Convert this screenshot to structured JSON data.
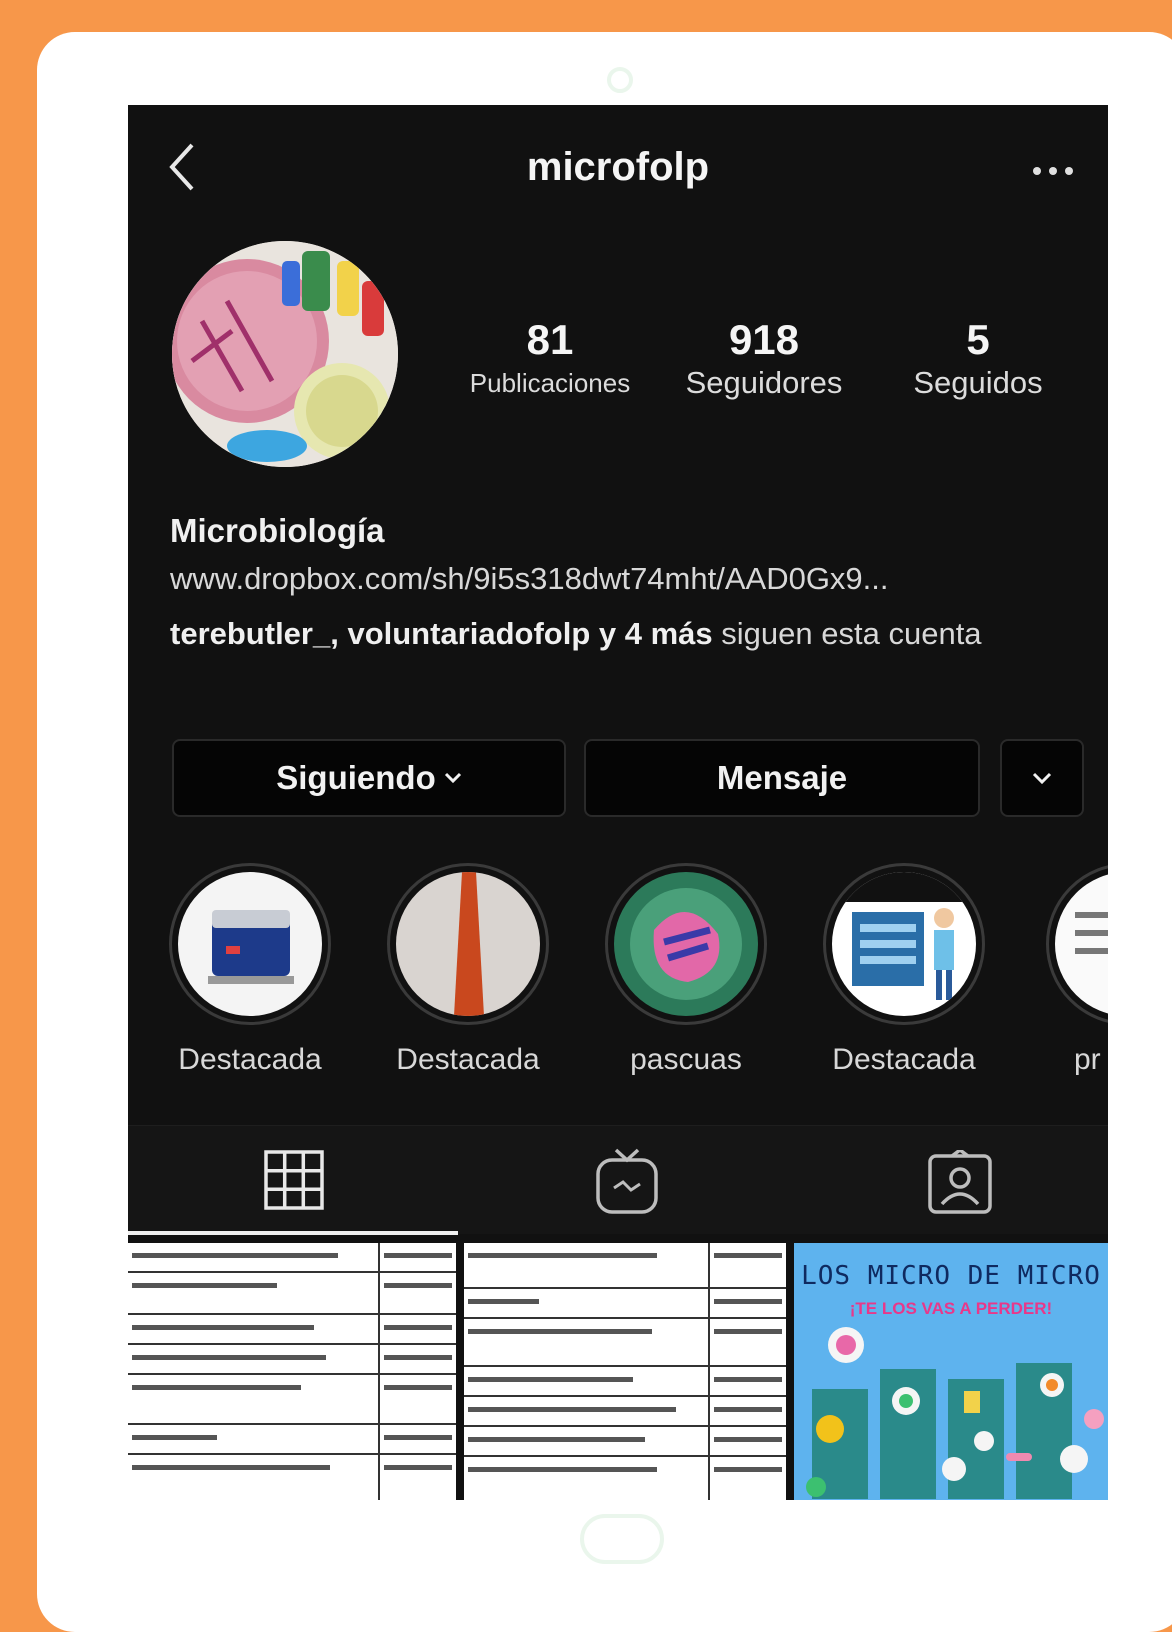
{
  "header": {
    "username": "microfolp"
  },
  "stats": [
    {
      "value": "81",
      "label": "Publicaciones"
    },
    {
      "value": "918",
      "label": "Seguidores"
    },
    {
      "value": "5",
      "label": "Seguidos"
    }
  ],
  "bio": {
    "name": "Microbiología",
    "link": "www.dropbox.com/sh/9i5s318dwt74mht/AAD0Gx9...",
    "followed_by_names": "terebutler_, voluntariadofolp",
    "followed_by_more": "y 4 más",
    "followed_by_suffix": "siguen esta cuenta"
  },
  "actions": {
    "following_label": "Siguiendo",
    "message_label": "Mensaje"
  },
  "highlights": [
    {
      "label": "Destacada"
    },
    {
      "label": "Destacada"
    },
    {
      "label": "pascuas"
    },
    {
      "label": "Destacada"
    },
    {
      "label": "pr"
    }
  ],
  "tabs": [
    "grid-icon",
    "igtv-icon",
    "tagged-icon"
  ],
  "posts": {
    "third_title": "LOS MICRO DE MICRO",
    "third_subtitle": "¡TE LOS VAS A PERDER!"
  },
  "colors": {
    "background": "#F7974A",
    "screen": "#111111",
    "post_blue": "#5EB3EE"
  }
}
